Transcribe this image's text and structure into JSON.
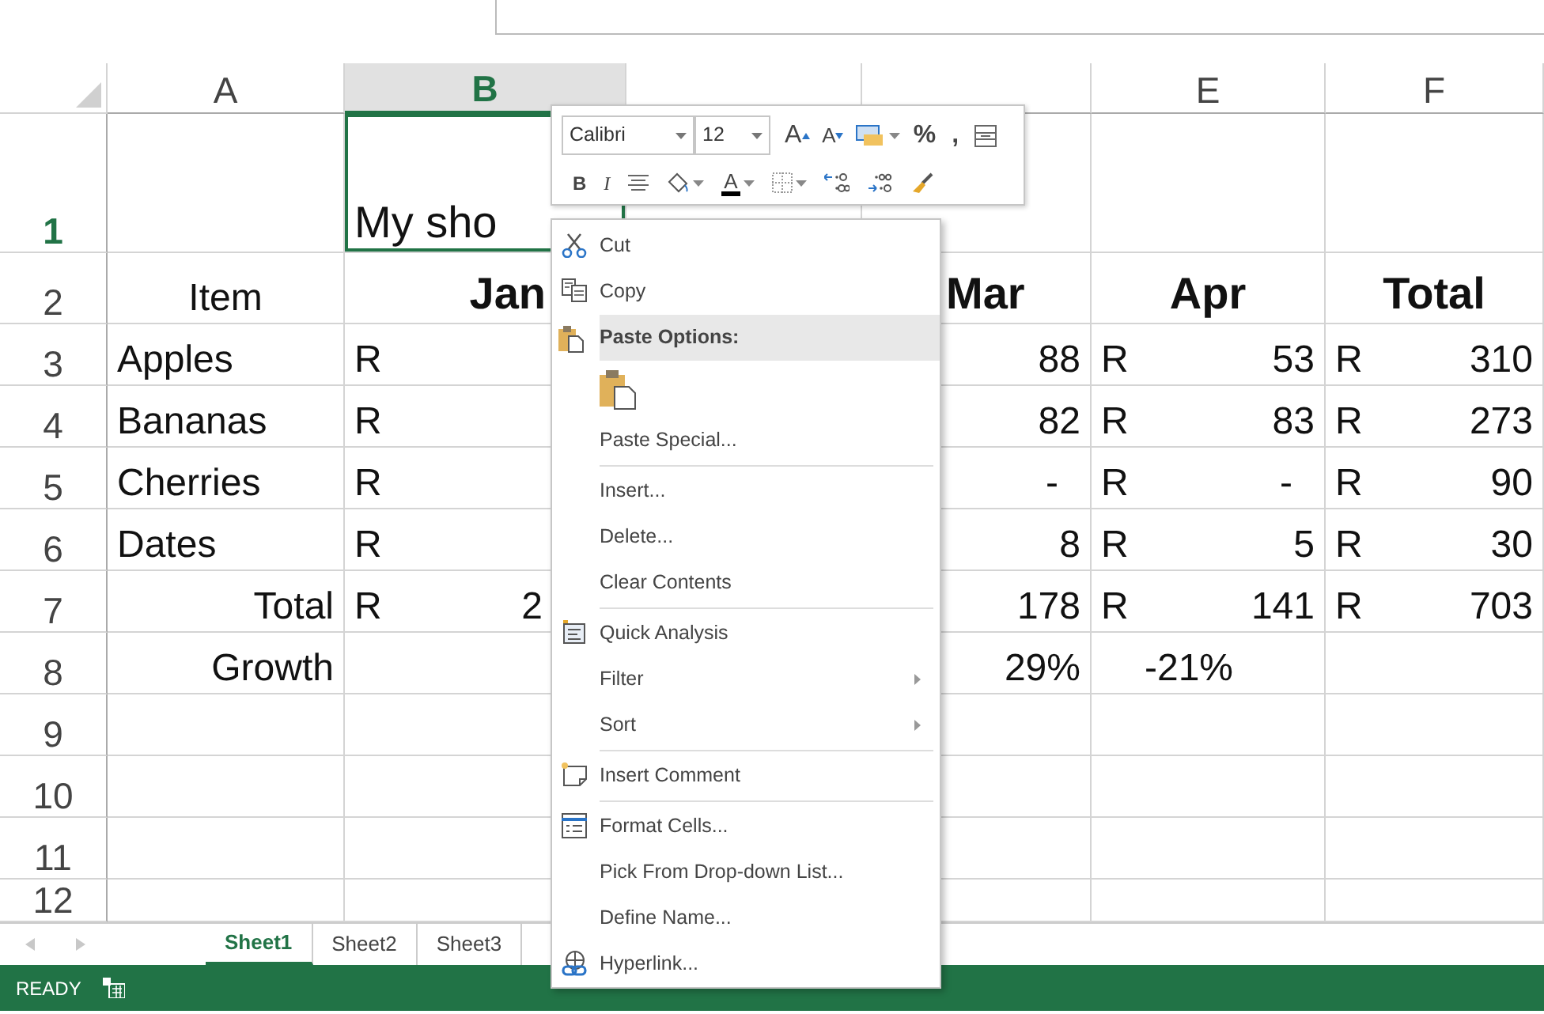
{
  "columns": [
    {
      "label": "A",
      "selected": false
    },
    {
      "label": "B",
      "selected": true
    },
    {
      "selected": false
    },
    {
      "selected": false
    },
    {
      "label": "E",
      "selected": false
    },
    {
      "label": "F",
      "selected": false
    }
  ],
  "rows": [
    {
      "label": "1",
      "selected": true,
      "cells": [
        {
          "kind": "empty"
        },
        {
          "kind": "text",
          "text": "My sho",
          "selected": true
        },
        {
          "kind": "empty"
        },
        {
          "kind": "empty"
        },
        {
          "kind": "empty"
        },
        {
          "kind": "empty"
        }
      ]
    },
    {
      "label": "2",
      "selected": false,
      "cells": [
        {
          "kind": "center",
          "text": "Item"
        },
        {
          "kind": "heading",
          "text": "Jan"
        },
        {
          "kind": "empty"
        },
        {
          "kind": "heading",
          "text": "Mar"
        },
        {
          "kind": "heading",
          "text": "Apr"
        },
        {
          "kind": "heading",
          "text": "Total"
        }
      ]
    },
    {
      "label": "3",
      "selected": false,
      "cells": [
        {
          "kind": "text",
          "text": "Apples"
        },
        {
          "kind": "currency",
          "symbol": "R"
        },
        {
          "kind": "empty"
        },
        {
          "kind": "currency",
          "amount": "88"
        },
        {
          "kind": "currency",
          "symbol": "R",
          "amount": "53"
        },
        {
          "kind": "currency",
          "symbol": "R",
          "amount": "310"
        }
      ]
    },
    {
      "label": "4",
      "selected": false,
      "cells": [
        {
          "kind": "text",
          "text": "Bananas"
        },
        {
          "kind": "currency",
          "symbol": "R"
        },
        {
          "kind": "empty"
        },
        {
          "kind": "currency",
          "amount": "82"
        },
        {
          "kind": "currency",
          "symbol": "R",
          "amount": "83"
        },
        {
          "kind": "currency",
          "symbol": "R",
          "amount": "273"
        }
      ]
    },
    {
      "label": "5",
      "selected": false,
      "cells": [
        {
          "kind": "text",
          "text": "Cherries"
        },
        {
          "kind": "currency",
          "symbol": "R"
        },
        {
          "kind": "empty"
        },
        {
          "kind": "currency",
          "amount": "-"
        },
        {
          "kind": "currency",
          "symbol": "R",
          "amount": "-"
        },
        {
          "kind": "currency",
          "symbol": "R",
          "amount": "90"
        }
      ]
    },
    {
      "label": "6",
      "selected": false,
      "cells": [
        {
          "kind": "text",
          "text": "Dates"
        },
        {
          "kind": "currency",
          "symbol": "R"
        },
        {
          "kind": "empty"
        },
        {
          "kind": "currency",
          "amount": "8"
        },
        {
          "kind": "currency",
          "symbol": "R",
          "amount": "5"
        },
        {
          "kind": "currency",
          "symbol": "R",
          "amount": "30"
        }
      ]
    },
    {
      "label": "7",
      "selected": false,
      "cells": [
        {
          "kind": "right",
          "text": "Total"
        },
        {
          "kind": "currency",
          "symbol": "R",
          "amount": "2"
        },
        {
          "kind": "empty"
        },
        {
          "kind": "currency",
          "amount": "178"
        },
        {
          "kind": "currency",
          "symbol": "R",
          "amount": "141"
        },
        {
          "kind": "currency",
          "symbol": "R",
          "amount": "703"
        }
      ]
    },
    {
      "label": "8",
      "selected": false,
      "cells": [
        {
          "kind": "right",
          "text": "Growth"
        },
        {
          "kind": "empty"
        },
        {
          "kind": "empty"
        },
        {
          "kind": "right",
          "text": "29%"
        },
        {
          "kind": "center",
          "text": "-21%"
        },
        {
          "kind": "empty"
        }
      ]
    },
    {
      "label": "9",
      "selected": false,
      "cells": []
    },
    {
      "label": "10",
      "selected": false,
      "cells": []
    },
    {
      "label": "11",
      "selected": false,
      "cells": []
    },
    {
      "label": "12",
      "selected": false,
      "cells": []
    }
  ],
  "mini_toolbar": {
    "font": "Calibri",
    "size": "12",
    "row1": [
      {
        "kind": "grow-font",
        "text": "A"
      },
      {
        "kind": "shrink-font",
        "text": "A"
      },
      {
        "kind": "number-format"
      },
      {
        "kind": "glyph",
        "text": "%"
      },
      {
        "kind": "glyph",
        "text": ","
      },
      {
        "kind": "wrap"
      }
    ],
    "row2": [
      {
        "kind": "bold",
        "text": "B"
      },
      {
        "kind": "italic",
        "text": "I"
      },
      {
        "kind": "align"
      },
      {
        "kind": "fill"
      },
      {
        "kind": "font-color",
        "text": "A"
      },
      {
        "kind": "borders"
      },
      {
        "kind": "increase-decimal"
      },
      {
        "kind": "decrease-decimal"
      },
      {
        "kind": "format-painter"
      }
    ]
  },
  "context_menu": [
    {
      "kind": "cut",
      "label": "Cut"
    },
    {
      "kind": "copy",
      "label": "Copy"
    },
    {
      "kind": "heading",
      "label": "Paste Options:"
    },
    {
      "kind": "paste-icons"
    },
    {
      "kind": "plain",
      "label": "Paste Special..."
    },
    {
      "kind": "separator"
    },
    {
      "kind": "plain",
      "label": "Insert..."
    },
    {
      "kind": "plain",
      "label": "Delete..."
    },
    {
      "kind": "plain",
      "label": "Clear Contents"
    },
    {
      "kind": "separator"
    },
    {
      "kind": "quick-analysis",
      "label": "Quick Analysis"
    },
    {
      "kind": "submenu",
      "label": "Filter"
    },
    {
      "kind": "submenu",
      "label": "Sort"
    },
    {
      "kind": "separator"
    },
    {
      "kind": "comment",
      "label": "Insert Comment"
    },
    {
      "kind": "separator"
    },
    {
      "kind": "format",
      "label": "Format Cells..."
    },
    {
      "kind": "plain",
      "label": "Pick From Drop-down List..."
    },
    {
      "kind": "plain",
      "label": "Define Name..."
    },
    {
      "kind": "hyperlink",
      "label": "Hyperlink..."
    }
  ],
  "sheet_tabs": [
    {
      "label": "Sheet1",
      "selected": true
    },
    {
      "label": "Sheet2",
      "selected": false
    },
    {
      "label": "Sheet3",
      "selected": false
    }
  ],
  "status_bar": {
    "text": "READY"
  }
}
